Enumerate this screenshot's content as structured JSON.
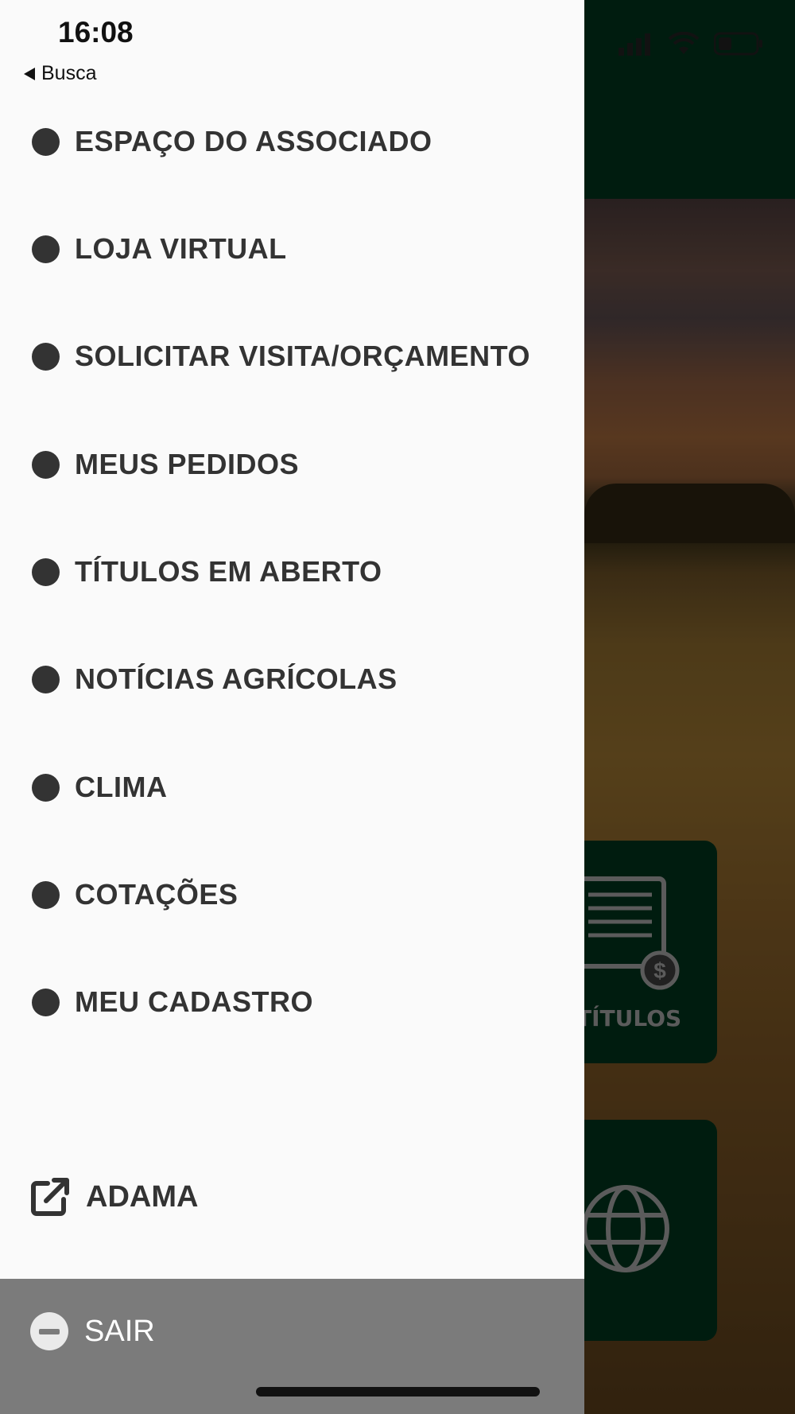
{
  "status_bar": {
    "time": "16:08",
    "back_label": "Busca"
  },
  "menu": {
    "items": [
      {
        "label": "ESPAÇO DO ASSOCIADO"
      },
      {
        "label": "LOJA VIRTUAL"
      },
      {
        "label": "SOLICITAR VISITA/ORÇAMENTO"
      },
      {
        "label": "MEUS PEDIDOS"
      },
      {
        "label": "TÍTULOS EM ABERTO"
      },
      {
        "label": "NOTÍCIAS AGRÍCOLAS"
      },
      {
        "label": "CLIMA"
      },
      {
        "label": "COTAÇÕES"
      },
      {
        "label": "MEU CADASTRO"
      }
    ],
    "external_link": {
      "label": "ADAMA",
      "icon": "external-link-icon"
    },
    "logout": {
      "label": "SAIR",
      "icon": "minus-circle-icon"
    }
  },
  "background": {
    "card_titulos_label": "TÍTULOS",
    "header_color": "#00341d"
  }
}
